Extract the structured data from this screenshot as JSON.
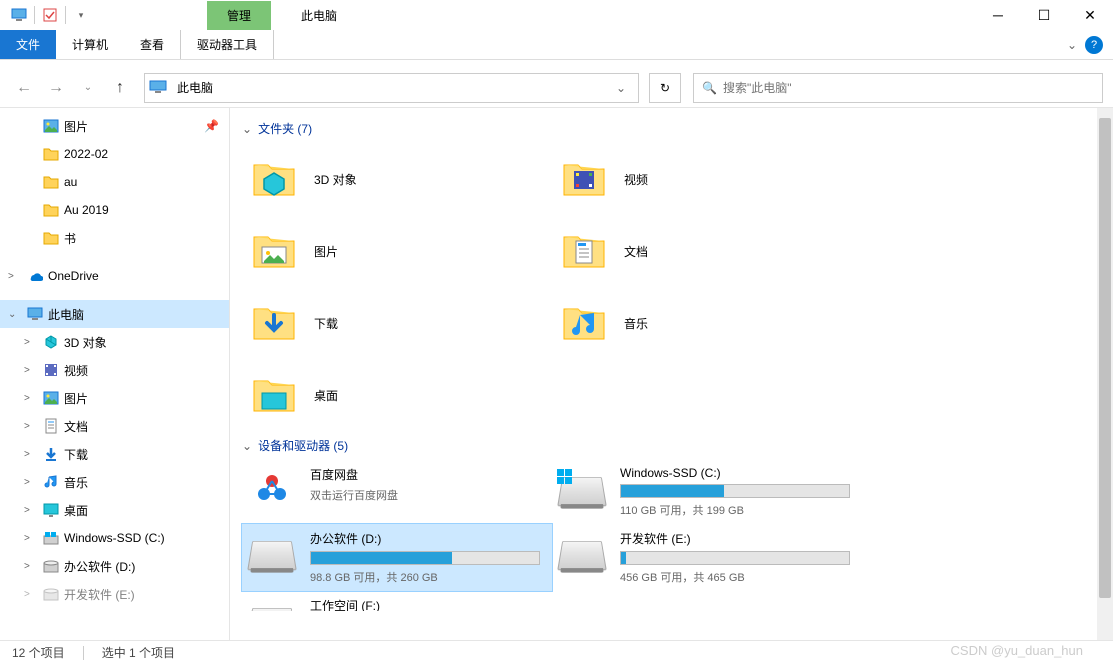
{
  "window": {
    "title": "此电脑",
    "tab_contextual": "管理"
  },
  "ribbon": {
    "file": "文件",
    "computer": "计算机",
    "view": "查看",
    "drive_tools": "驱动器工具"
  },
  "nav": {
    "address": "此电脑",
    "search_placeholder": "搜索\"此电脑\""
  },
  "sidebar": {
    "items": [
      {
        "label": "图片",
        "icon": "pictures",
        "indent": 1,
        "pin": true
      },
      {
        "label": "2022-02",
        "icon": "folder",
        "indent": 1
      },
      {
        "label": "au",
        "icon": "folder",
        "indent": 1
      },
      {
        "label": "Au 2019",
        "icon": "folder",
        "indent": 1
      },
      {
        "label": "书",
        "icon": "folder",
        "indent": 1
      },
      {
        "label": "OneDrive",
        "icon": "onedrive",
        "indent": 0,
        "expand": ">"
      },
      {
        "label": "此电脑",
        "icon": "pc",
        "indent": 0,
        "expand": "⌄",
        "selected": true
      },
      {
        "label": "3D 对象",
        "icon": "3d",
        "indent": 1,
        "expand": ">"
      },
      {
        "label": "视频",
        "icon": "video",
        "indent": 1,
        "expand": ">"
      },
      {
        "label": "图片",
        "icon": "pictures",
        "indent": 1,
        "expand": ">"
      },
      {
        "label": "文档",
        "icon": "docs",
        "indent": 1,
        "expand": ">"
      },
      {
        "label": "下载",
        "icon": "download",
        "indent": 1,
        "expand": ">"
      },
      {
        "label": "音乐",
        "icon": "music",
        "indent": 1,
        "expand": ">"
      },
      {
        "label": "桌面",
        "icon": "desktop",
        "indent": 1,
        "expand": ">"
      },
      {
        "label": "Windows-SSD (C:)",
        "icon": "disk-win",
        "indent": 1,
        "expand": ">"
      },
      {
        "label": "办公软件 (D:)",
        "icon": "disk",
        "indent": 1,
        "expand": ">"
      },
      {
        "label": "开发软件 (E:)",
        "icon": "disk",
        "indent": 1,
        "expand": ">",
        "cut": true
      }
    ]
  },
  "sections": {
    "folders_header": "文件夹 (7)",
    "drives_header": "设备和驱动器 (5)"
  },
  "folders": [
    {
      "name": "3D 对象",
      "icon": "3d"
    },
    {
      "name": "视频",
      "icon": "video"
    },
    {
      "name": "图片",
      "icon": "pictures"
    },
    {
      "name": "文档",
      "icon": "docs"
    },
    {
      "name": "下载",
      "icon": "download"
    },
    {
      "name": "音乐",
      "icon": "music"
    },
    {
      "name": "桌面",
      "icon": "desktop"
    }
  ],
  "drives": [
    {
      "name": "百度网盘",
      "sub": "双击运行百度网盘",
      "type": "app"
    },
    {
      "name": "Windows-SSD (C:)",
      "space": "110 GB 可用，共 199 GB",
      "fill": 45,
      "type": "win"
    },
    {
      "name": "办公软件 (D:)",
      "space": "98.8 GB 可用，共 260 GB",
      "fill": 62,
      "selected": true
    },
    {
      "name": "开发软件 (E:)",
      "space": "456 GB 可用，共 465 GB",
      "fill": 2
    },
    {
      "name": "工作空间 (F:)",
      "space": "",
      "fill": 0,
      "cut": true
    }
  ],
  "status": {
    "count": "12 个项目",
    "selected": "选中 1 个项目"
  },
  "watermark": "CSDN @yu_duan_hun"
}
